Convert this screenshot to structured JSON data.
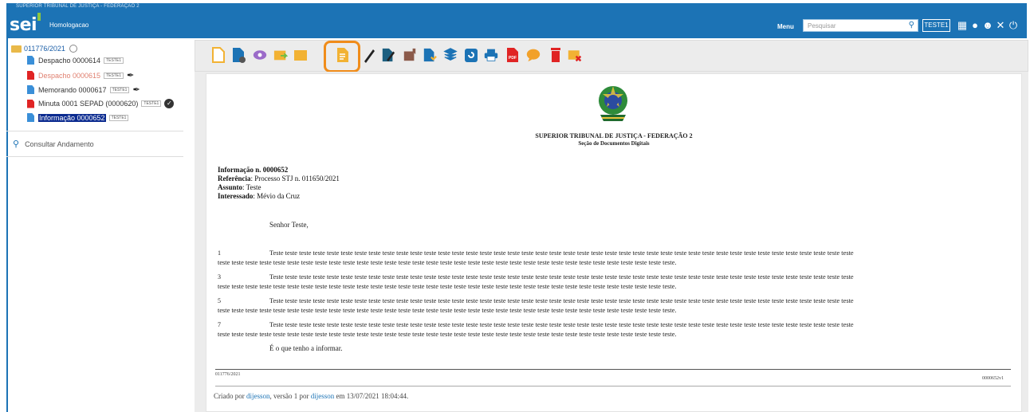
{
  "header": {
    "org_small": "SUPERIOR TRIBUNAL DE JUSTIÇA - FEDERAÇÃO 2",
    "logo": "sei",
    "environment": "Homologacao",
    "menu_label": "Menu",
    "search_placeholder": "Pesquisar",
    "unit": "TESTE1",
    "icons": [
      "search-icon",
      "grid-icon",
      "info-icon",
      "user-icon",
      "tools-icon",
      "power-icon"
    ]
  },
  "tree": {
    "process": "011776/2021",
    "items": [
      {
        "label": "Despacho 0000614",
        "tag": "TESTE1",
        "icon": "document-icon",
        "color": "#3a8fd8"
      },
      {
        "label": "Despacho 0000615",
        "tag": "TESTE1",
        "icon": "cancelled-document-icon",
        "color": "#e02424"
      },
      {
        "label": "Memorando 0000617",
        "tag": "TESTE1",
        "icon": "document-icon",
        "color": "#3a8fd8"
      },
      {
        "label": "Minuta 0001 SEPAD (0000620)",
        "tag": "TESTE1",
        "icon": "pdf-document-icon",
        "color": "#e02424"
      },
      {
        "label": "Informação 0000652",
        "tag": "TESTE1",
        "icon": "document-icon",
        "color": "#3a8fd8"
      }
    ],
    "consult": "Consultar Andamento"
  },
  "toolbar": {
    "buttons": [
      "new-document-icon",
      "process-settings-icon",
      "view-icon",
      "send-process-icon",
      "folder-icon",
      "edit-document-icon",
      "sign-icon",
      "block-sign-icon",
      "bookmark-icon",
      "attach-icon",
      "layers-icon",
      "refresh-icon",
      "print-icon",
      "pdf-icon",
      "comment-icon",
      "delete-icon",
      "close-process-icon"
    ],
    "selected": "edit-document-icon",
    "selected_color": "#f08c1a"
  },
  "document": {
    "org_title": "SUPERIOR TRIBUNAL DE JUSTIÇA - FEDERAÇÃO 2",
    "org_sub": "Seção de Documentos Digitais",
    "info_label": "Informação n. 0000652",
    "ref_key": "Referência",
    "ref_val": ": Processo STJ n. 011650/2021",
    "subj_key": "Assunto",
    "subj_val": ": Teste",
    "int_key": "Interessado",
    "int_val": ": Mévio da Cruz",
    "greeting": "Senhor Teste,",
    "paragraphs": [
      {
        "num": "1",
        "line1": "Teste teste teste teste teste teste teste teste teste teste teste teste teste teste teste teste teste teste teste teste teste teste teste teste teste teste teste teste teste teste teste teste teste teste teste teste teste teste teste teste teste teste",
        "line2": "teste teste teste teste teste teste teste teste teste teste teste teste teste teste teste teste teste teste teste teste teste teste teste teste teste teste teste teste teste teste teste teste teste."
      },
      {
        "num": "3",
        "line1": "Teste teste teste teste teste teste teste teste teste teste teste teste teste teste teste teste teste teste teste teste teste teste teste teste teste teste teste teste teste teste teste teste teste teste teste teste teste teste teste teste teste teste",
        "line2": "teste teste teste teste teste teste teste teste teste teste teste teste teste teste teste teste teste teste teste teste teste teste teste teste teste teste teste teste teste teste teste teste teste."
      },
      {
        "num": "5",
        "line1": "Teste teste teste teste teste teste teste teste teste teste teste teste teste teste teste teste teste teste teste teste teste teste teste teste teste teste teste teste teste teste teste teste teste teste teste teste teste teste teste teste teste teste",
        "line2": "teste teste teste teste teste teste teste teste teste teste teste teste teste teste teste teste teste teste teste teste teste teste teste teste teste teste teste teste teste teste teste teste teste."
      },
      {
        "num": "7",
        "line1": "Teste teste teste teste teste teste teste teste teste teste teste teste teste teste teste teste teste teste teste teste teste teste teste teste teste teste teste teste teste teste teste teste teste teste teste teste teste teste teste teste teste teste",
        "line2": "teste teste teste teste teste teste teste teste teste teste teste teste teste teste teste teste teste teste teste teste teste teste teste teste teste teste teste teste teste teste teste teste teste."
      }
    ],
    "closing": "É o que tenho a informar.",
    "footer_left": "011776/2021",
    "footer_right": "0000652v1"
  },
  "created": {
    "prefix": "Criado por",
    "user1": "dijesson",
    "mid": ", versão 1 por",
    "user2": "dijesson",
    "suffix": "em 13/07/2021 18:04:44."
  }
}
